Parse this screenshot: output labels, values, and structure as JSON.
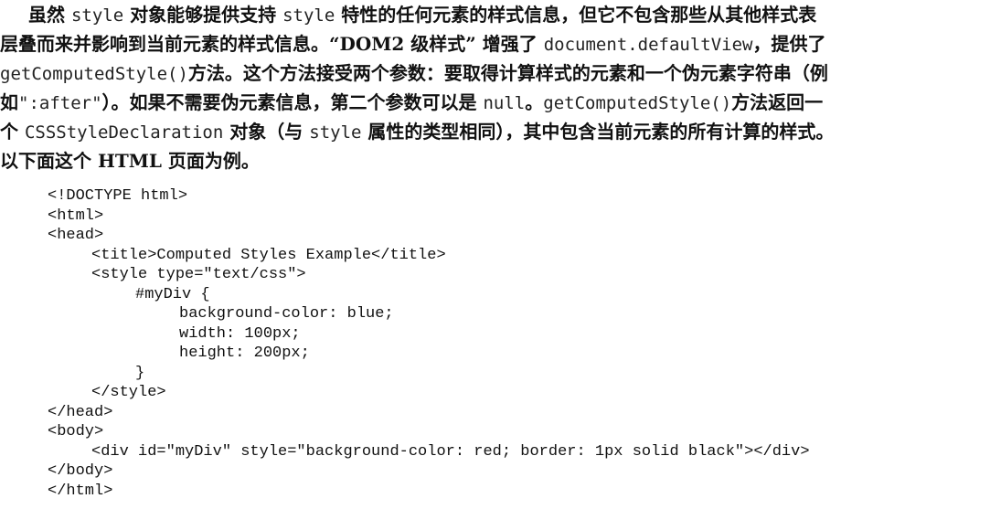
{
  "paragraph": {
    "line1": [
      {
        "t": "虽然 ",
        "code": false
      },
      {
        "t": "style",
        "code": true
      },
      {
        "t": " 对象能够提供支持 ",
        "code": false
      },
      {
        "t": "style",
        "code": true
      },
      {
        "t": " 特性的任何元素的样式信息，但它不包含那些从其他样式表",
        "code": false
      }
    ],
    "line2": [
      {
        "t": "层叠而来并影响到当前元素的样式信息。“DOM2 级样式” 增强了 ",
        "code": false
      },
      {
        "t": "document.defaultView",
        "code": true
      },
      {
        "t": "，提供了",
        "code": false
      }
    ],
    "line3": [
      {
        "t": "getComputedStyle()",
        "code": true
      },
      {
        "t": "方法。这个方法接受两个参数：要取得计算样式的元素和一个伪元素字符串（例",
        "code": false
      }
    ],
    "line4": [
      {
        "t": "如",
        "code": false
      },
      {
        "t": "\":after\"",
        "code": true
      },
      {
        "t": "）。如果不需要伪元素信息，第二个参数可以是 ",
        "code": false
      },
      {
        "t": "null",
        "code": true
      },
      {
        "t": "。",
        "code": false
      },
      {
        "t": "getComputedStyle()",
        "code": true
      },
      {
        "t": "方法返回一",
        "code": false
      }
    ],
    "line5": [
      {
        "t": "个 ",
        "code": false
      },
      {
        "t": "CSSStyleDeclaration",
        "code": true
      },
      {
        "t": " 对象（与 ",
        "code": false
      },
      {
        "t": "style",
        "code": true
      },
      {
        "t": " 属性的类型相同），其中包含当前元素的所有计算的样式。",
        "code": false
      }
    ],
    "line6": [
      {
        "t": "以下面这个 HTML 页面为例。",
        "code": false
      }
    ]
  },
  "code_listing": {
    "lines": [
      {
        "indent": 0,
        "text": "<!DOCTYPE html>"
      },
      {
        "indent": 0,
        "text": "<html>"
      },
      {
        "indent": 0,
        "text": "<head>"
      },
      {
        "indent": 1,
        "text": "<title>Computed Styles Example</title>"
      },
      {
        "indent": 1,
        "text": "<style type=\"text/css\">"
      },
      {
        "indent": 2,
        "text": "#myDiv {"
      },
      {
        "indent": 3,
        "text": "background-color: blue;"
      },
      {
        "indent": 3,
        "text": "width: 100px;"
      },
      {
        "indent": 3,
        "text": "height: 200px;"
      },
      {
        "indent": 2,
        "text": "}"
      },
      {
        "indent": 1,
        "text": "</style>"
      },
      {
        "indent": 0,
        "text": "</head>"
      },
      {
        "indent": 0,
        "text": "<body>"
      },
      {
        "indent": 1,
        "text": "<div id=\"myDiv\" style=\"background-color: red; border: 1px solid black\"></div>"
      },
      {
        "indent": 0,
        "text": "</body>"
      },
      {
        "indent": 0,
        "text": "</html>"
      }
    ]
  }
}
